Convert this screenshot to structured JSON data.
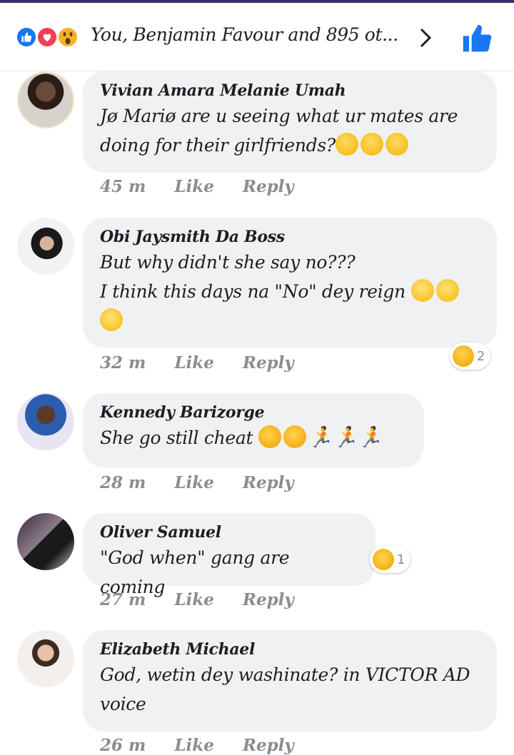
{
  "header": {
    "reaction_summary": "You, Benjamin Favour and 895 ot...",
    "reaction_icons": [
      "like-icon",
      "love-icon",
      "wow-icon"
    ]
  },
  "comments": [
    {
      "author": "Vivian Amara Melanie Umah",
      "lines": [
        "Jø Mariø are u seeing what ur mates are",
        "doing for their girlfriends?"
      ],
      "emojis": [
        "unamused-face",
        "unamused-face",
        "unamused-face"
      ],
      "time": "45 m",
      "like": "Like",
      "reply": "Reply"
    },
    {
      "author": "Obi Jaysmith Da Boss",
      "lines": [
        "But why didn't she say no???",
        "I think this days na \"No\" dey reign"
      ],
      "emojis": [
        "grinning-face",
        "grinning-face",
        "grinning-face"
      ],
      "time": "32 m",
      "like": "Like",
      "reply": "Reply",
      "reaction_count": "2"
    },
    {
      "author": "Kennedy Barizorge",
      "lines": [
        "She go still cheat"
      ],
      "emojis": [
        "rofl-face",
        "rofl-face",
        "running-man",
        "running-man",
        "running-man"
      ],
      "time": "28 m",
      "like": "Like",
      "reply": "Reply"
    },
    {
      "author": "Oliver Samuel",
      "lines": [
        "\"God when\" gang are coming"
      ],
      "time": "27 m",
      "like": "Like",
      "reply": "Reply",
      "reaction_count": "1"
    },
    {
      "author": "Elizabeth Michael",
      "lines": [
        "God, wetin dey washinate?  in VICTOR AD",
        "voice"
      ],
      "time": "26 m",
      "like": "Like",
      "reply": "Reply"
    }
  ],
  "colors": {
    "brand_blue": "#1877f2",
    "bubble_bg": "#eff1f3",
    "meta_gray": "#8a8d91"
  }
}
